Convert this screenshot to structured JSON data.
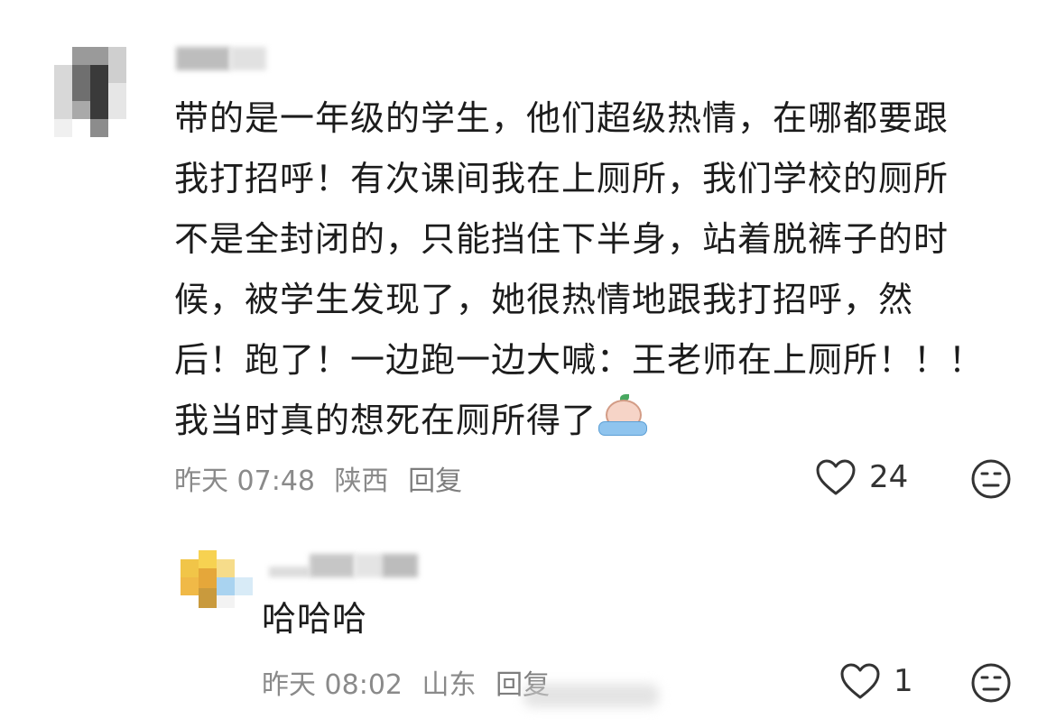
{
  "main_comment": {
    "text_lines": [
      "带的是一年级的学生，他们超级热情，在哪都要跟",
      "我打招呼！有次课间我在上厕所，我们学校的厕所",
      "不是全封闭的，只能挡住下半身，站着脱裤子的时",
      "候，被学生发现了，她很热情地跟我打招呼，然",
      "后！跑了！一边跑一边大喊：王老师在上厕所！！！",
      "我当时真的想死在厕所得了"
    ],
    "emoji": "crying-emoji",
    "time": "昨天 07:48",
    "location": "陕西",
    "reply_label": "回复",
    "like_count": "24"
  },
  "reply_comment": {
    "text": "哈哈哈",
    "time": "昨天 08:02",
    "location": "山东",
    "reply_label": "回复",
    "like_count": "1"
  },
  "icons": {
    "like": "heart-outline-icon",
    "dislike": "meh-face-icon"
  }
}
